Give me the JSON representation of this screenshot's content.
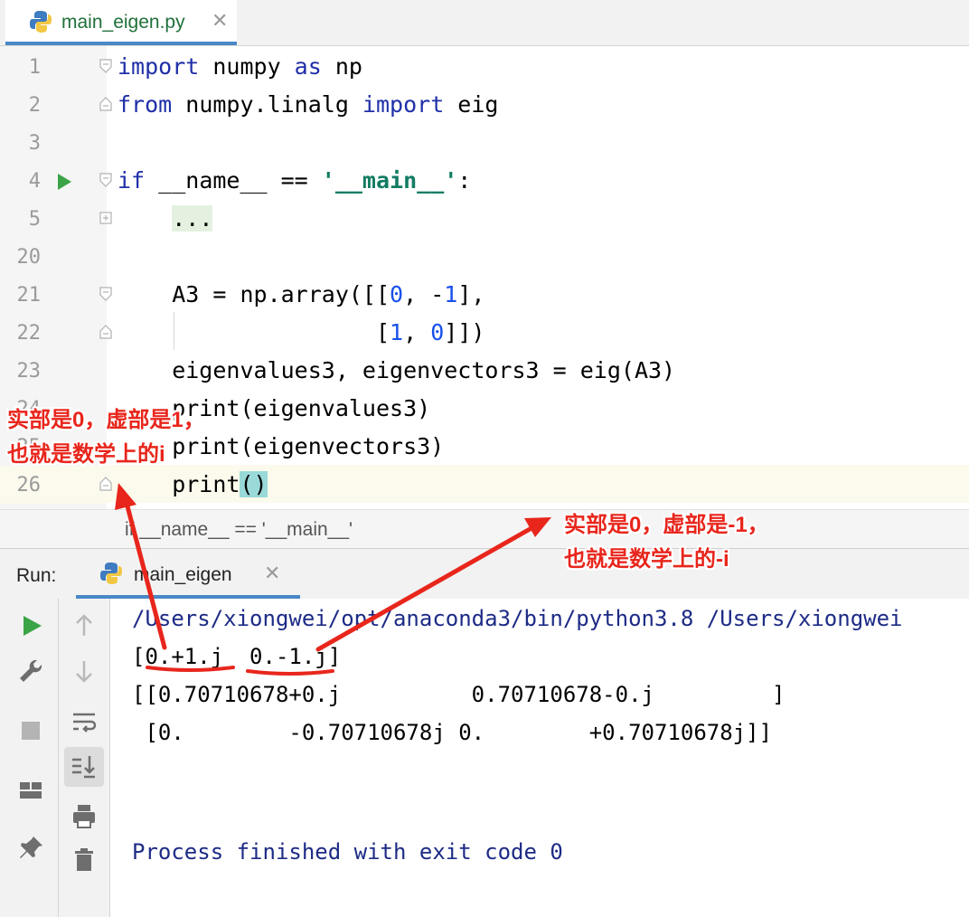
{
  "editor_tab": {
    "filename": "main_eigen.py",
    "close": "✕"
  },
  "code_lines": [
    {
      "num": "1",
      "segments": [
        {
          "t": "import",
          "c": "kw"
        },
        {
          "t": " numpy ",
          "c": ""
        },
        {
          "t": "as",
          "c": "kw"
        },
        {
          "t": " np",
          "c": ""
        }
      ]
    },
    {
      "num": "2",
      "segments": [
        {
          "t": "from",
          "c": "kw"
        },
        {
          "t": " numpy.linalg ",
          "c": ""
        },
        {
          "t": "import",
          "c": "kw"
        },
        {
          "t": " eig",
          "c": ""
        }
      ]
    },
    {
      "num": "3",
      "segments": []
    },
    {
      "num": "4",
      "segments": [
        {
          "t": "if",
          "c": "kw"
        },
        {
          "t": " __name__ == ",
          "c": ""
        },
        {
          "t": "'__main__'",
          "c": "str"
        },
        {
          "t": ":",
          "c": ""
        }
      ]
    },
    {
      "num": "5",
      "segments": [
        {
          "t": "    ",
          "c": ""
        },
        {
          "t": "...",
          "c": "fold-placeholder"
        }
      ]
    },
    {
      "num": "20",
      "segments": []
    },
    {
      "num": "21",
      "segments": [
        {
          "t": "    A3 = np.array([[",
          "c": ""
        },
        {
          "t": "0",
          "c": "num"
        },
        {
          "t": ", -",
          "c": ""
        },
        {
          "t": "1",
          "c": "num"
        },
        {
          "t": "],",
          "c": ""
        }
      ]
    },
    {
      "num": "22",
      "segments": [
        {
          "t": "                   [",
          "c": ""
        },
        {
          "t": "1",
          "c": "num"
        },
        {
          "t": ", ",
          "c": ""
        },
        {
          "t": "0",
          "c": "num"
        },
        {
          "t": "]])",
          "c": ""
        }
      ]
    },
    {
      "num": "23",
      "segments": [
        {
          "t": "    eigenvalues3, eigenvectors3 = eig(A3)",
          "c": ""
        }
      ]
    },
    {
      "num": "24",
      "segments": [
        {
          "t": "    print(eigenvalues3)",
          "c": ""
        }
      ]
    },
    {
      "num": "25",
      "segments": [
        {
          "t": "    print(eigenvectors3)",
          "c": ""
        }
      ]
    },
    {
      "num": "26",
      "segments": [
        {
          "t": "    print",
          "c": ""
        },
        {
          "t": "()",
          "c": "paren-hl"
        }
      ]
    }
  ],
  "breadcrumb": "if __name__ == '__main__'",
  "run_panel": {
    "label": "Run:",
    "tab": "main_eigen",
    "close": "✕"
  },
  "console_lines": [
    {
      "text": "/Users/xiongwei/opt/anaconda3/bin/python3.8 /Users/xiongwei",
      "style": "blue"
    },
    {
      "text": "[0.+1.j  0.-1.j]",
      "style": ""
    },
    {
      "text": "[[0.70710678+0.j          0.70710678-0.j         ]",
      "style": ""
    },
    {
      "text": " [0.        -0.70710678j 0.        +0.70710678j]]",
      "style": ""
    },
    {
      "text": "",
      "style": ""
    },
    {
      "text": "",
      "style": ""
    },
    {
      "text": "Process finished with exit code 0",
      "style": "blue"
    }
  ],
  "annotations": {
    "left": "实部是0，虚部是1，\n也就是数学上的i",
    "right": "实部是0，虚部是-1，\n也就是数学上的-i"
  },
  "colors": {
    "annotation": "#e8261c",
    "keyword": "#1f2fa8",
    "string": "#127c63",
    "number": "#1750eb",
    "run_green": "#3aa446",
    "tab_underline": "#4a88c7"
  }
}
